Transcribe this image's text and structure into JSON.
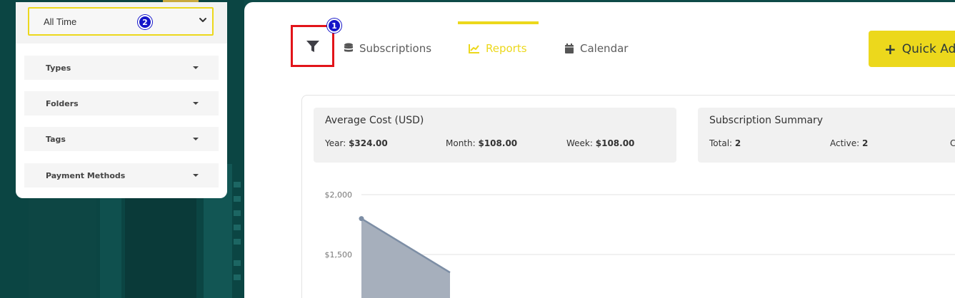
{
  "filters": {
    "period": {
      "selected": "All Time"
    },
    "badge_period": "2",
    "sections": [
      {
        "label": "Types"
      },
      {
        "label": "Folders"
      },
      {
        "label": "Tags"
      },
      {
        "label": "Payment Methods"
      }
    ]
  },
  "tabs": {
    "filter_badge": "1",
    "items": [
      {
        "label": "Subscriptions",
        "icon": "database-icon"
      },
      {
        "label": "Reports",
        "icon": "chart-line-icon",
        "active": true
      },
      {
        "label": "Calendar",
        "icon": "calendar-icon"
      }
    ]
  },
  "actions": {
    "quick_add_label": "Quick Ad"
  },
  "average_cost": {
    "title": "Average Cost (USD)",
    "year_label": "Year:",
    "year_value": "$324.00",
    "month_label": "Month:",
    "month_value": "$108.00",
    "week_label": "Week:",
    "week_value": "$108.00"
  },
  "summary": {
    "title": "Subscription Summary",
    "total_label": "Total:",
    "total_value": "2",
    "active_label": "Active:",
    "active_value": "2",
    "cut_label": "C"
  },
  "colors": {
    "accent": "#ecd81c",
    "highlight": "#e2141a",
    "badge": "#1516c9",
    "series": "#7d8ea5"
  },
  "chart_data": {
    "type": "area",
    "y_ticks": [
      "$2,000",
      "$1,500"
    ],
    "ylim": [
      1500,
      2000
    ],
    "series": [
      {
        "values": [
          {
            "x": 0,
            "y": 1800
          },
          {
            "x": 1,
            "y": 1350
          }
        ]
      }
    ]
  }
}
